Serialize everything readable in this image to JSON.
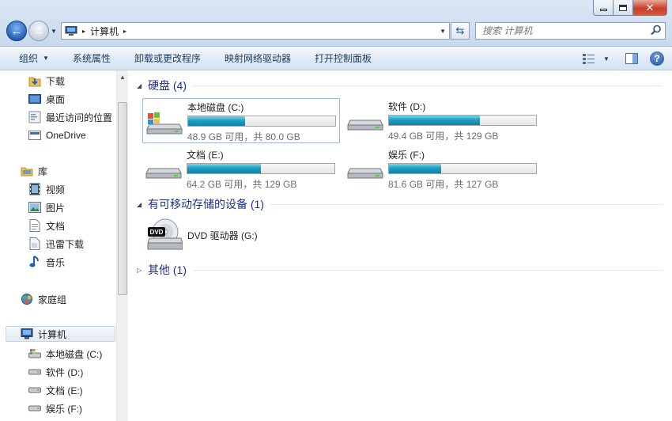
{
  "window": {
    "close_glyph": "✕"
  },
  "nav_buttons": {
    "back_glyph": "←",
    "forward_glyph": "→"
  },
  "address": {
    "crumb": "计算机",
    "separator": "▸",
    "icon": "computer-icon"
  },
  "search": {
    "placeholder": "搜索 计算机"
  },
  "toolbar": {
    "items": [
      "组织",
      "系统属性",
      "卸载或更改程序",
      "映射网络驱动器",
      "打开控制面板"
    ],
    "help_glyph": "?"
  },
  "sidebar": {
    "items": [
      {
        "label": "下载",
        "icon": "downloads-folder-icon"
      },
      {
        "label": "桌面",
        "icon": "desktop-icon"
      },
      {
        "label": "最近访问的位置",
        "icon": "recent-places-icon"
      },
      {
        "label": "OneDrive",
        "icon": "onedrive-icon"
      },
      {
        "label": "库",
        "icon": "libraries-icon"
      },
      {
        "label": "视频",
        "icon": "videos-icon"
      },
      {
        "label": "图片",
        "icon": "pictures-icon"
      },
      {
        "label": "文档",
        "icon": "documents-icon"
      },
      {
        "label": "迅雷下载",
        "icon": "folder-icon"
      },
      {
        "label": "音乐",
        "icon": "music-icon"
      },
      {
        "label": "家庭组",
        "icon": "homegroup-icon"
      },
      {
        "label": "计算机",
        "icon": "computer-icon"
      },
      {
        "label": "本地磁盘 (C:)",
        "icon": "system-drive-icon"
      },
      {
        "label": "软件 (D:)",
        "icon": "drive-icon"
      },
      {
        "label": "文档 (E:)",
        "icon": "drive-icon"
      },
      {
        "label": "娱乐 (F:)",
        "icon": "drive-icon"
      }
    ]
  },
  "groups": {
    "hard_disks": {
      "title": "硬盘 (4)"
    },
    "removable": {
      "title": "有可移动存储的设备 (1)"
    },
    "other": {
      "title": "其他 (1)"
    }
  },
  "drives": [
    {
      "name": "本地磁盘 (C:)",
      "size_text": "48.9 GB 可用，共 80.0 GB",
      "used_fraction": 0.389,
      "icon": "system-drive-icon"
    },
    {
      "name": "软件 (D:)",
      "size_text": "49.4 GB 可用，共 129 GB",
      "used_fraction": 0.617,
      "icon": "drive-icon"
    },
    {
      "name": "文档 (E:)",
      "size_text": "64.2 GB 可用，共 129 GB",
      "used_fraction": 0.502,
      "icon": "drive-icon"
    },
    {
      "name": "娱乐 (F:)",
      "size_text": "81.6 GB 可用，共 127 GB",
      "used_fraction": 0.357,
      "icon": "drive-icon"
    }
  ],
  "dvd": {
    "name": "DVD 驱动器 (G:)",
    "badge": "DVD",
    "icon": "dvd-drive-icon"
  },
  "colors": {
    "bar_fill": "#1f9ec4",
    "group_title": "#1e3287"
  }
}
